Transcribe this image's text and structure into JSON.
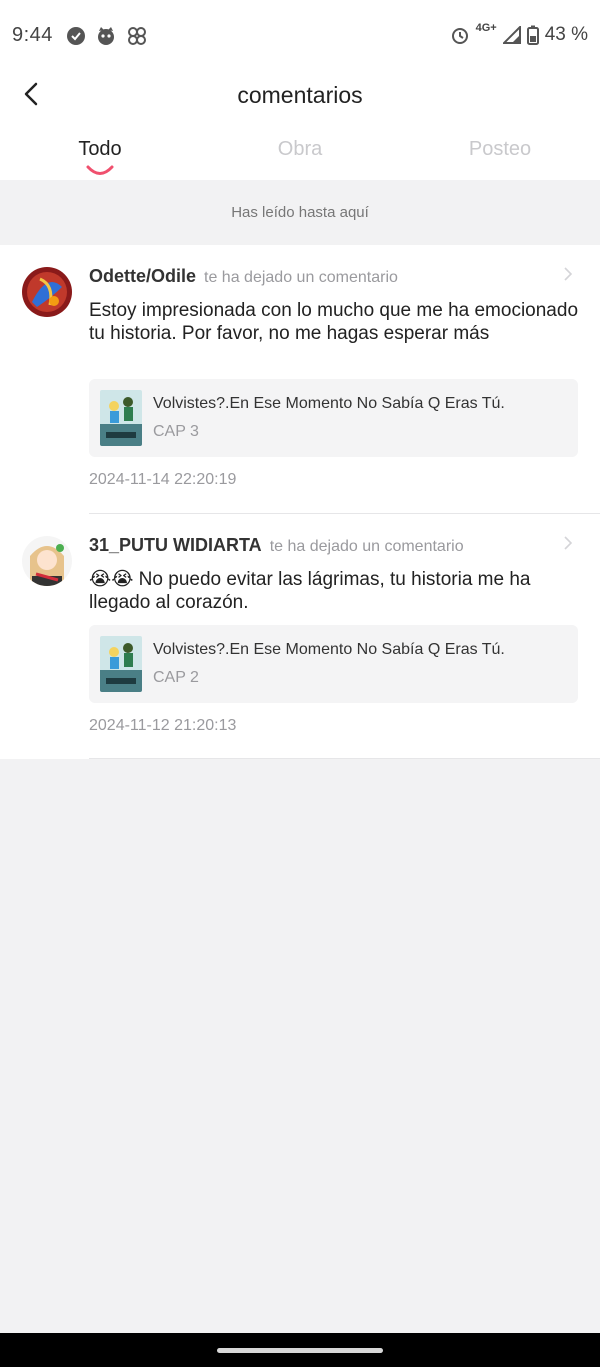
{
  "status_bar": {
    "time": "9:44",
    "network": "4G+",
    "battery": "43 %",
    "icons": [
      "check-circle-icon",
      "cat-face-icon",
      "pinwheel-icon",
      "alarm-icon",
      "signal-icon",
      "battery-icon"
    ]
  },
  "header": {
    "title": "comentarios",
    "back_icon": "back-arrow-icon"
  },
  "tabs": [
    {
      "label": "Todo",
      "active": true
    },
    {
      "label": "Obra",
      "active": false
    },
    {
      "label": "Posteo",
      "active": false
    }
  ],
  "read_marker": "Has leído hasta aquí",
  "notifications": [
    {
      "user": "Odette/Odile",
      "action": "te ha dejado un comentario",
      "comment": "Estoy impresionada con lo mucho que me ha emocionado tu historia. Por favor, no me hagas esperar más",
      "work_title": "Volvistes?.En Ese Momento No Sabía Q Eras Tú.",
      "chapter": "CAP 3",
      "date": "2024-11-14 22:20:19"
    },
    {
      "user": "31_PUTU WIDIARTA",
      "action": "te ha dejado un comentario",
      "comment": "😭😭 No puedo evitar las lágrimas, tu historia me ha llegado al corazón.",
      "work_title": "Volvistes?.En Ese Momento No Sabía Q Eras Tú.",
      "chapter": "CAP 2",
      "date": "2024-11-12 21:20:13"
    }
  ],
  "colors": {
    "accent": "#f0506e",
    "background": "#f2f2f3",
    "card": "#f4f4f5"
  }
}
